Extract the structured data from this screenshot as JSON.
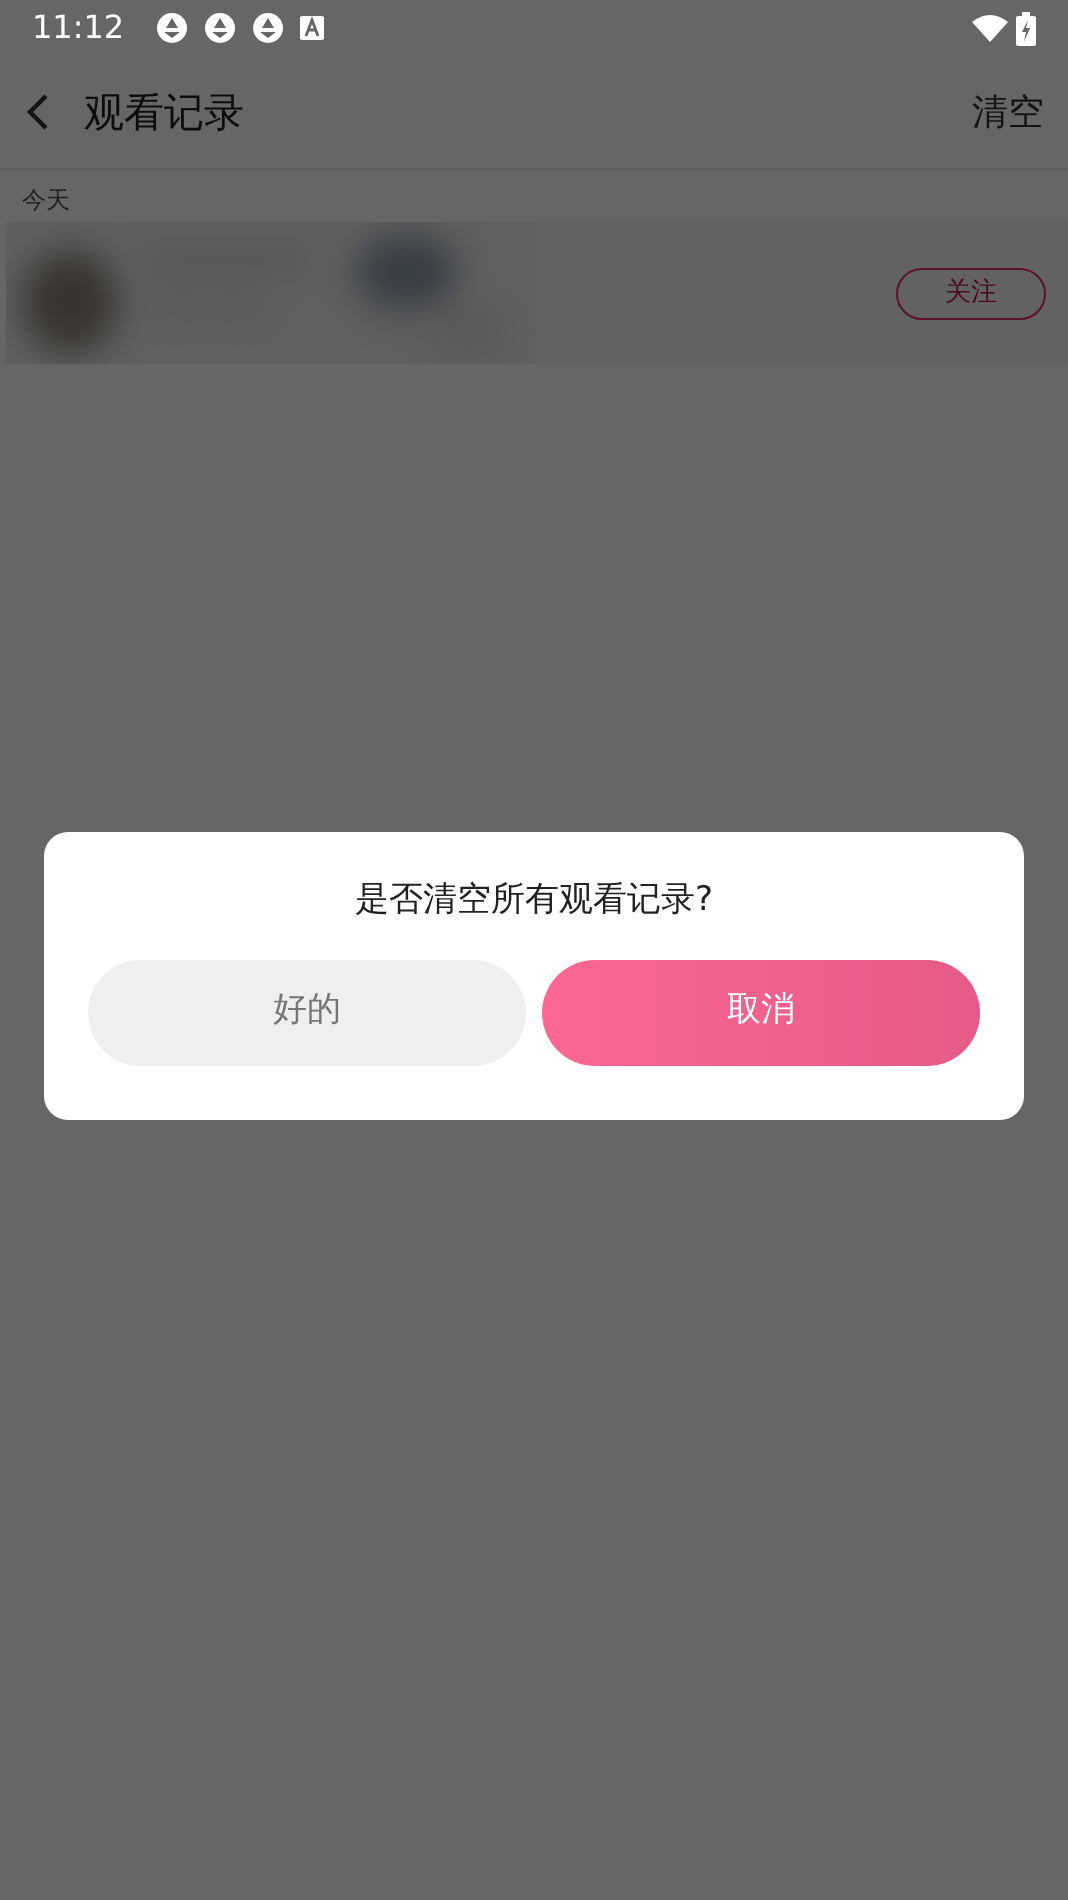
{
  "status_bar": {
    "time": "11:12"
  },
  "header": {
    "title": "观看记录",
    "action": "清空"
  },
  "sections": [
    {
      "label": "今天",
      "items": [
        {
          "kind": "picture",
          "follow_button": "关注"
        }
      ]
    }
  ],
  "dialog": {
    "message": "是否清空所有观看记录?",
    "buttons": [
      {
        "label": "好的",
        "kind": "secondary"
      },
      {
        "label": "取消",
        "kind": "primary"
      }
    ]
  }
}
